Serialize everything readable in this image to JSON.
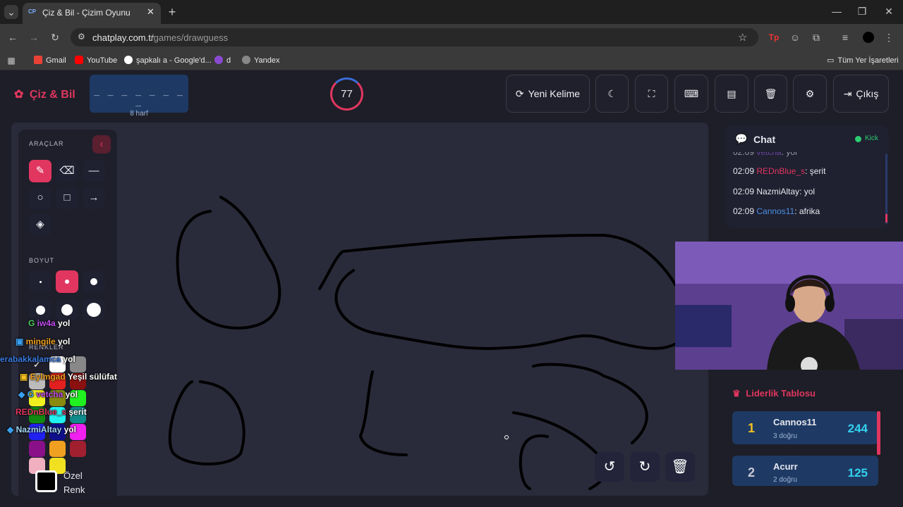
{
  "browser": {
    "tab_title": "Çiz & Bil - Çizim Oyunu",
    "tab_favicon": "CP",
    "url_host": "chatplay.com.tr",
    "url_path": "/games/drawguess",
    "bookmarks": [
      "Gmail",
      "YouTube",
      "şapkalı a - Google'd...",
      "d",
      "Yandex"
    ],
    "all_bookmarks": "Tüm Yer İşaretleri"
  },
  "app": {
    "logo": "Çiz & Bil",
    "word_mask": "_ _ _ _ _ _ _ _",
    "word_hint": "8 harf",
    "timer": "77",
    "timer_progress": 0.1,
    "new_word": "Yeni Kelime",
    "exit": "Çıkış"
  },
  "tools": {
    "title": "ARAÇLAR",
    "size_title": "BOYUT",
    "colors_title": "RENKLER",
    "custom_color": [
      "Özel",
      "Renk"
    ],
    "colors": [
      "#ffffff",
      "#888888",
      "#bbbbbb",
      "#e32020",
      "#8b1010",
      "#f0f020",
      "#8a8a10",
      "#20f020",
      "#108a10",
      "#20f0f0",
      "#108a8a",
      "#2020f0",
      "#10108a",
      "#f020f0",
      "#8a108a",
      "#f0a020",
      "#a02030",
      "#f0b0c0",
      "#f0e020"
    ]
  },
  "overlay_guesses": [
    {
      "name": "iw4a",
      "text": "yol",
      "color": "#c04cf0"
    },
    {
      "name": "mingile",
      "text": "yol",
      "color": "#f0a020"
    },
    {
      "name": "erabakkalamca",
      "text": "yol",
      "color": "#3a7adf"
    },
    {
      "name": "Eylmgad",
      "text": "Yeşil sülüfat",
      "color": "#f0a020"
    },
    {
      "name": "vetcha",
      "text": "yol",
      "color": "#c04cf0"
    },
    {
      "name": "REDnBlue_s",
      "text": "şerit",
      "color": "#e0365f"
    },
    {
      "name": "NazmiAltay",
      "text": "yol",
      "color": "#a0d4f0"
    }
  ],
  "chat": {
    "title": "Chat",
    "status": "Kick",
    "messages": [
      {
        "time": "02:09",
        "user": "vetcha",
        "text": ": yol",
        "color": "#a060f0"
      },
      {
        "time": "02:09",
        "user": "REDnBlue_s",
        "text": ": şerit",
        "color": "#e0365f"
      },
      {
        "time": "02:09",
        "user": "NazmiAltay",
        "text": ": yol",
        "color": "#e8e8ee"
      },
      {
        "time": "02:09",
        "user": "Cannos11",
        "text": ": afrika",
        "color": "#4a90e0"
      }
    ]
  },
  "leaderboard": {
    "title": "Liderlik Tablosu",
    "rows": [
      {
        "rank": "1",
        "name": "Cannos11",
        "sub": "3 doğru",
        "score": "244"
      },
      {
        "rank": "2",
        "name": "Acurr",
        "sub": "2 doğru",
        "score": "125"
      }
    ]
  },
  "icons": [
    "search-icon",
    "star-icon",
    "undo-icon",
    "redo-icon",
    "trash-icon",
    "gear-icon",
    "moon-icon",
    "fullscreen-icon",
    "keyboard-icon",
    "archive-icon",
    "refresh-icon",
    "logout-icon",
    "brush-icon",
    "eraser-icon",
    "line-icon",
    "circle-icon",
    "square-icon",
    "arrow-icon",
    "fill-icon",
    "chat-icon",
    "crown-icon",
    "chevron-left-icon"
  ]
}
